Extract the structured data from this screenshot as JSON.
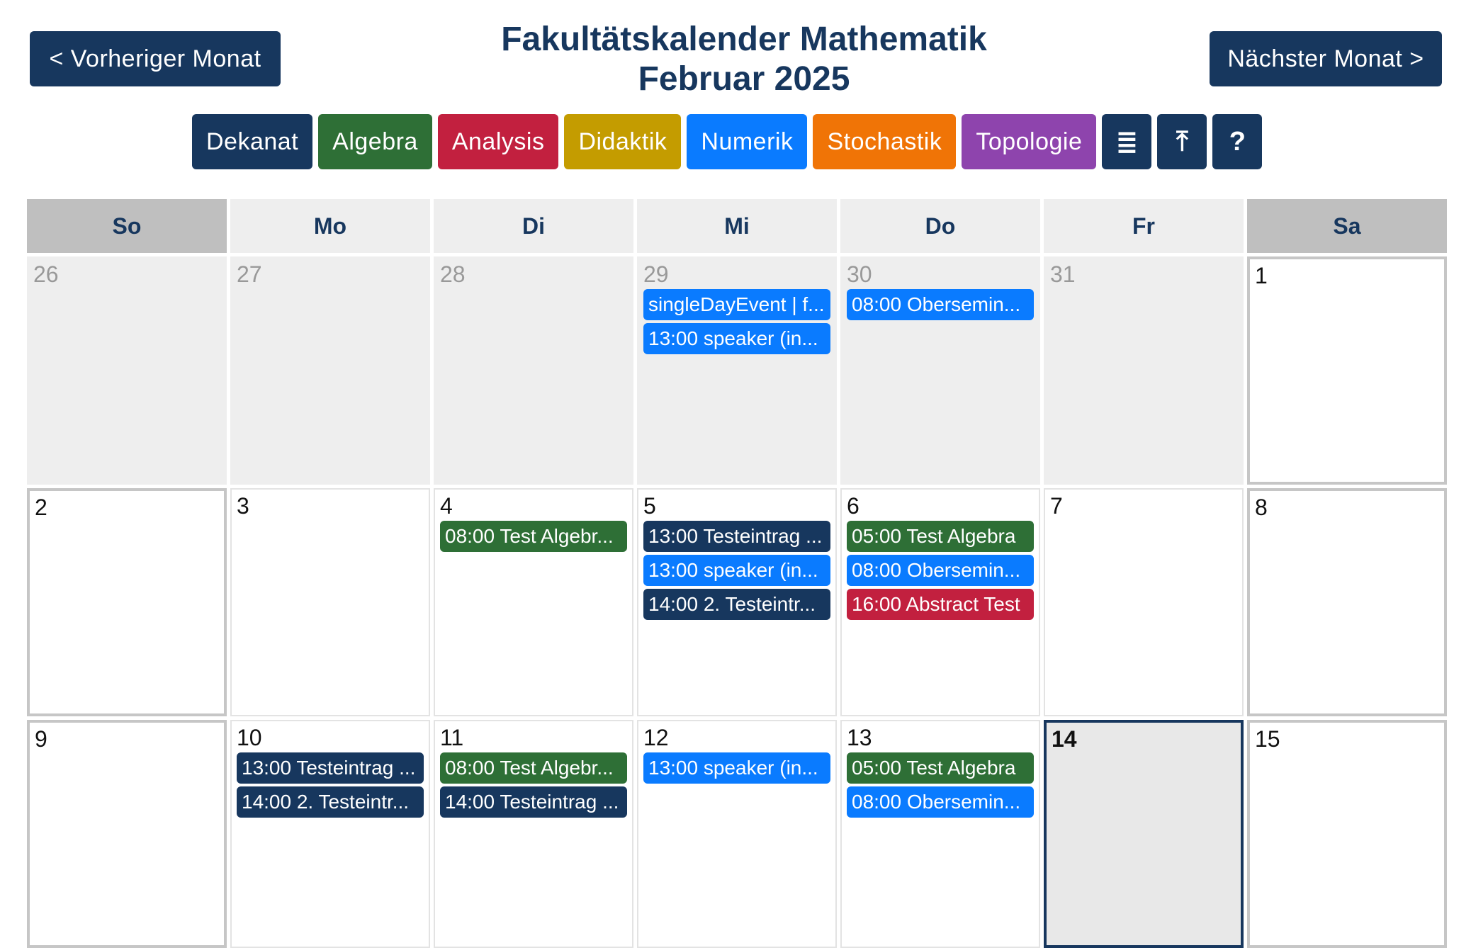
{
  "header": {
    "prev_label": "< Vorheriger Monat",
    "next_label": "Nächster Monat >",
    "title_line1": "Fakultätskalender Mathematik",
    "title_line2": "Februar 2025"
  },
  "colors": {
    "navy": "#17375e",
    "green": "#2e6f36",
    "red": "#c2203f",
    "gold": "#c49c00",
    "blue": "#0a7bff",
    "orange": "#f07406",
    "purple": "#8e44ad"
  },
  "filters": [
    {
      "label": "Dekanat",
      "color": "#17375e"
    },
    {
      "label": "Algebra",
      "color": "#2e6f36"
    },
    {
      "label": "Analysis",
      "color": "#c2203f"
    },
    {
      "label": "Didaktik",
      "color": "#c49c00"
    },
    {
      "label": "Numerik",
      "color": "#0a7bff"
    },
    {
      "label": "Stochastik",
      "color": "#f07406"
    },
    {
      "label": "Topologie",
      "color": "#8e44ad"
    }
  ],
  "toolbar_icons": [
    {
      "name": "list-icon",
      "glyph": "≣"
    },
    {
      "name": "upload-icon",
      "glyph": "⤒"
    },
    {
      "name": "help-icon",
      "glyph": "?"
    }
  ],
  "weekdays": [
    "So",
    "Mo",
    "Di",
    "Mi",
    "Do",
    "Fr",
    "Sa"
  ],
  "weeks": [
    [
      {
        "day": "26",
        "other": true,
        "events": []
      },
      {
        "day": "27",
        "other": true,
        "events": []
      },
      {
        "day": "28",
        "other": true,
        "events": []
      },
      {
        "day": "29",
        "other": true,
        "events": [
          {
            "text": "singleDayEvent | f...",
            "color": "#0a7bff"
          },
          {
            "text": "13:00 speaker (in...",
            "color": "#0a7bff"
          }
        ]
      },
      {
        "day": "30",
        "other": true,
        "events": [
          {
            "text": "08:00 Obersemin...",
            "color": "#0a7bff"
          }
        ]
      },
      {
        "day": "31",
        "other": true,
        "events": []
      },
      {
        "day": "1",
        "other": false,
        "events": []
      }
    ],
    [
      {
        "day": "2",
        "other": false,
        "events": []
      },
      {
        "day": "3",
        "other": false,
        "events": []
      },
      {
        "day": "4",
        "other": false,
        "events": [
          {
            "text": "08:00 Test Algebr...",
            "color": "#2e6f36"
          }
        ]
      },
      {
        "day": "5",
        "other": false,
        "events": [
          {
            "text": "13:00 Testeintrag ...",
            "color": "#17375e"
          },
          {
            "text": "13:00 speaker (in...",
            "color": "#0a7bff"
          },
          {
            "text": "14:00 2. Testeintr...",
            "color": "#17375e"
          }
        ]
      },
      {
        "day": "6",
        "other": false,
        "events": [
          {
            "text": "05:00 Test Algebra",
            "color": "#2e6f36"
          },
          {
            "text": "08:00 Obersemin...",
            "color": "#0a7bff"
          },
          {
            "text": "16:00 Abstract Test",
            "color": "#c2203f"
          }
        ]
      },
      {
        "day": "7",
        "other": false,
        "events": []
      },
      {
        "day": "8",
        "other": false,
        "events": []
      }
    ],
    [
      {
        "day": "9",
        "other": false,
        "events": []
      },
      {
        "day": "10",
        "other": false,
        "events": [
          {
            "text": "13:00 Testeintrag ...",
            "color": "#17375e"
          },
          {
            "text": "14:00 2. Testeintr...",
            "color": "#17375e"
          }
        ]
      },
      {
        "day": "11",
        "other": false,
        "events": [
          {
            "text": "08:00 Test Algebr...",
            "color": "#2e6f36"
          },
          {
            "text": "14:00 Testeintrag ...",
            "color": "#17375e"
          }
        ]
      },
      {
        "day": "12",
        "other": false,
        "events": [
          {
            "text": "13:00 speaker (in...",
            "color": "#0a7bff"
          }
        ]
      },
      {
        "day": "13",
        "other": false,
        "events": [
          {
            "text": "05:00 Test Algebra",
            "color": "#2e6f36"
          },
          {
            "text": "08:00 Obersemin...",
            "color": "#0a7bff"
          }
        ]
      },
      {
        "day": "14",
        "other": false,
        "today": true,
        "events": []
      },
      {
        "day": "15",
        "other": false,
        "events": []
      }
    ]
  ]
}
